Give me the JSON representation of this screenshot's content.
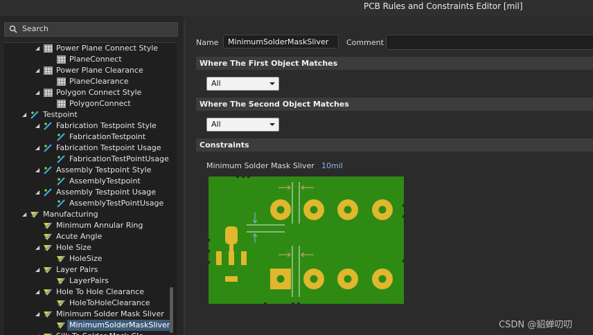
{
  "window": {
    "title": "PCB Rules and Constraints Editor [mil]"
  },
  "search": {
    "placeholder": "Search"
  },
  "tree": [
    {
      "label": "Power Plane Connect Style",
      "indent": 2,
      "arrow": "down",
      "icon": "grid-icon"
    },
    {
      "label": "PlaneConnect",
      "indent": 3,
      "arrow": "",
      "icon": "grid-icon"
    },
    {
      "label": "Power Plane Clearance",
      "indent": 2,
      "arrow": "down",
      "icon": "grid-icon"
    },
    {
      "label": "PlaneClearance",
      "indent": 3,
      "arrow": "",
      "icon": "grid-icon"
    },
    {
      "label": "Polygon Connect Style",
      "indent": 2,
      "arrow": "down",
      "icon": "grid-icon"
    },
    {
      "label": "PolygonConnect",
      "indent": 3,
      "arrow": "",
      "icon": "grid-icon"
    },
    {
      "label": "Testpoint",
      "indent": 1,
      "arrow": "down",
      "icon": "testpoint-icon"
    },
    {
      "label": "Fabrication Testpoint Style",
      "indent": 2,
      "arrow": "down",
      "icon": "testpoint-icon"
    },
    {
      "label": "FabricationTestpoint",
      "indent": 3,
      "arrow": "",
      "icon": "testpoint-icon"
    },
    {
      "label": "Fabrication Testpoint Usage",
      "indent": 2,
      "arrow": "down",
      "icon": "testpoint-icon"
    },
    {
      "label": "FabricationTestPointUsage",
      "indent": 3,
      "arrow": "",
      "icon": "testpoint-icon"
    },
    {
      "label": "Assembly Testpoint Style",
      "indent": 2,
      "arrow": "down",
      "icon": "testpoint-icon"
    },
    {
      "label": "AssemblyTestpoint",
      "indent": 3,
      "arrow": "",
      "icon": "testpoint-icon"
    },
    {
      "label": "Assembly Testpoint Usage",
      "indent": 2,
      "arrow": "down",
      "icon": "testpoint-icon"
    },
    {
      "label": "AssemblyTestPointUsage",
      "indent": 3,
      "arrow": "",
      "icon": "testpoint-icon"
    },
    {
      "label": "Manufacturing",
      "indent": 1,
      "arrow": "down",
      "icon": "manufacturing-icon"
    },
    {
      "label": "Minimum Annular Ring",
      "indent": 2,
      "arrow": "",
      "icon": "manufacturing-icon"
    },
    {
      "label": "Acute Angle",
      "indent": 2,
      "arrow": "",
      "icon": "manufacturing-icon"
    },
    {
      "label": "Hole Size",
      "indent": 2,
      "arrow": "down",
      "icon": "manufacturing-icon"
    },
    {
      "label": "HoleSize",
      "indent": 3,
      "arrow": "",
      "icon": "manufacturing-icon"
    },
    {
      "label": "Layer Pairs",
      "indent": 2,
      "arrow": "down",
      "icon": "manufacturing-icon"
    },
    {
      "label": "LayerPairs",
      "indent": 3,
      "arrow": "",
      "icon": "manufacturing-icon"
    },
    {
      "label": "Hole To Hole Clearance",
      "indent": 2,
      "arrow": "down",
      "icon": "manufacturing-icon"
    },
    {
      "label": "HoleToHoleClearance",
      "indent": 3,
      "arrow": "",
      "icon": "manufacturing-icon"
    },
    {
      "label": "Minimum Solder Mask Sliver",
      "indent": 2,
      "arrow": "down",
      "icon": "manufacturing-icon"
    },
    {
      "label": "MinimumSolderMaskSliver",
      "indent": 3,
      "arrow": "",
      "icon": "manufacturing-icon",
      "selected": true
    },
    {
      "label": "Silk To Solder Mask Cle",
      "indent": 2,
      "arrow": "down",
      "icon": "manufacturing-icon"
    }
  ],
  "editor": {
    "name_label": "Name",
    "name_value": "MinimumSolderMaskSliver",
    "comment_label": "Comment",
    "first_match_header": "Where The First Object Matches",
    "first_match_value": "All",
    "second_match_header": "Where The Second Object Matches",
    "second_match_value": "All",
    "constraints_header": "Constraints",
    "constraint_label": "Minimum Solder Mask Sliver",
    "constraint_value": "10mil"
  },
  "colors": {
    "board": "#2f8a14",
    "pad": "#e0b72d",
    "hole": "#2f8a14",
    "selection": "#3d5a78",
    "value_text": "#8ab8ea"
  },
  "watermark": "CSDN @貂蝉叨叨"
}
